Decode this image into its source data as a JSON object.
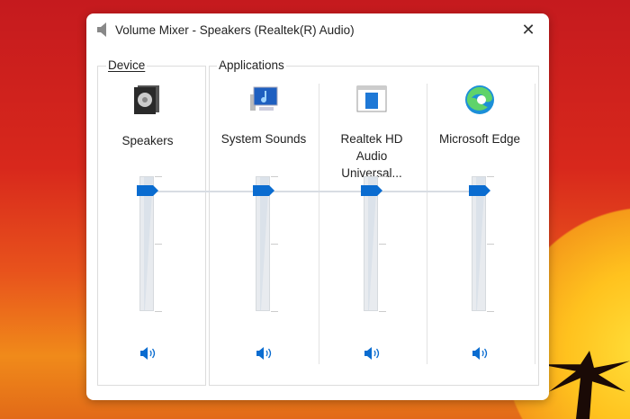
{
  "window": {
    "title": "Volume Mixer - Speakers (Realtek(R) Audio)",
    "close_label": "✕"
  },
  "device": {
    "group_label": "Device",
    "name": "Speakers",
    "volume_percent": 90
  },
  "applications": {
    "group_label": "Applications",
    "items": [
      {
        "name": "System Sounds",
        "volume_percent": 90,
        "icon": "system-sounds-icon"
      },
      {
        "name": "Realtek HD Audio Universal...",
        "volume_percent": 90,
        "icon": "app-window-icon"
      },
      {
        "name": "Microsoft Edge",
        "volume_percent": 90,
        "icon": "edge-icon"
      }
    ]
  },
  "colors": {
    "accent": "#0a6cd0"
  }
}
